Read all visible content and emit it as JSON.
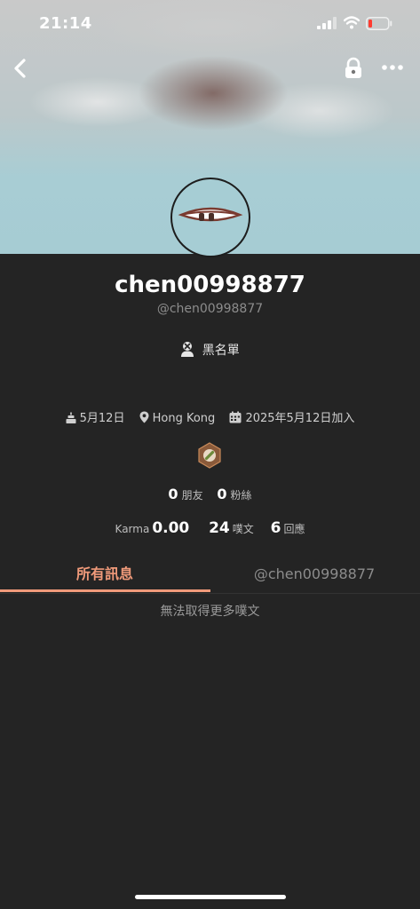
{
  "status_bar": {
    "time": "21:14"
  },
  "profile": {
    "display_name": "chen00998877",
    "handle": "@chen00998877",
    "blacklist_label": "黑名單",
    "birthday": "5月12日",
    "location": "Hong Kong",
    "joined": "2025年5月12日加入"
  },
  "counts": {
    "friends_value": "0",
    "friends_label": "朋友",
    "fans_value": "0",
    "fans_label": "粉絲"
  },
  "stats": {
    "karma_label": "Karma",
    "karma_value": "0.00",
    "plurks_value": "24",
    "plurks_label": "噗文",
    "responses_value": "6",
    "responses_label": "回應"
  },
  "tabs": [
    {
      "label": "所有訊息",
      "active": true
    },
    {
      "label": "@chen00998877",
      "active": false
    }
  ],
  "empty_message": "無法取得更多噗文",
  "colors": {
    "accent": "#f09a7a",
    "background": "#242424",
    "badge": "#8a5a3a"
  }
}
